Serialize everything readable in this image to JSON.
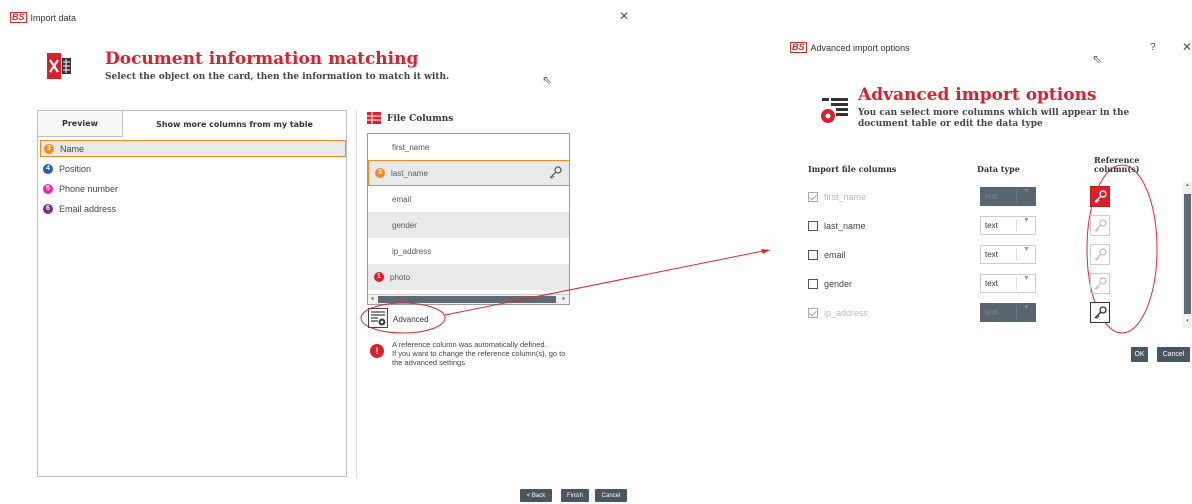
{
  "main_dialog": {
    "app_logo": "BS",
    "title": "Import data",
    "close_glyph": "✕",
    "heading": "Document information matching",
    "subheading": "Select the object on the card, then the information to match it with.",
    "tabs": [
      {
        "label": "Preview"
      },
      {
        "label": "Show more columns from my table"
      }
    ],
    "properties": [
      {
        "num": "3",
        "label": "Name",
        "color": "#f08a24"
      },
      {
        "num": "4",
        "label": "Position",
        "color": "#1e5cbf"
      },
      {
        "num": "5",
        "label": "Phone number",
        "color": "#e62ba0"
      },
      {
        "num": "6",
        "label": "Email address",
        "color": "#7b2c8f"
      }
    ],
    "file_columns_title": "File Columns",
    "file_columns": [
      {
        "label": "first_name",
        "num": ""
      },
      {
        "label": "last_name",
        "num": "3"
      },
      {
        "label": "email",
        "num": ""
      },
      {
        "label": "gender",
        "num": ""
      },
      {
        "label": "ip_address",
        "num": ""
      },
      {
        "label": "photo",
        "num": "1"
      }
    ],
    "advanced_label": "Advanced",
    "info_lines": [
      "A reference column was automatically defined.",
      "If you want to change the reference column(s), go to",
      "the advanced settings"
    ],
    "buttons": {
      "back": "< Back",
      "finish": "Finish",
      "cancel": "Cancel"
    }
  },
  "advanced_dialog": {
    "app_logo": "BS",
    "title": "Advanced import options",
    "help_glyph": "?",
    "heading": "Advanced import options",
    "subheading_line1": "You can select more columns which will appear in the",
    "subheading_line2": "document table or edit the data type",
    "columns": {
      "import": "Import file columns",
      "datatype": "Data type",
      "reference_line1": "Reference",
      "reference_line2": "column(s)"
    },
    "rows": [
      {
        "label": "first_name",
        "type": "text",
        "checked": true,
        "disabled": true,
        "key": "red"
      },
      {
        "label": "last_name",
        "type": "text",
        "checked": false,
        "disabled": false,
        "key": "off"
      },
      {
        "label": "email",
        "type": "text",
        "checked": false,
        "disabled": false,
        "key": "off"
      },
      {
        "label": "gender",
        "type": "text",
        "checked": false,
        "disabled": false,
        "key": "off"
      },
      {
        "label": "ip_address",
        "type": "text",
        "checked": true,
        "disabled": true,
        "key": "on"
      }
    ],
    "buttons": {
      "ok": "OK",
      "cancel": "Cancel"
    }
  },
  "colors": {
    "accent_red": "#d9202c",
    "highlight_orange": "#f08a24",
    "button_dark": "#4a5560"
  }
}
